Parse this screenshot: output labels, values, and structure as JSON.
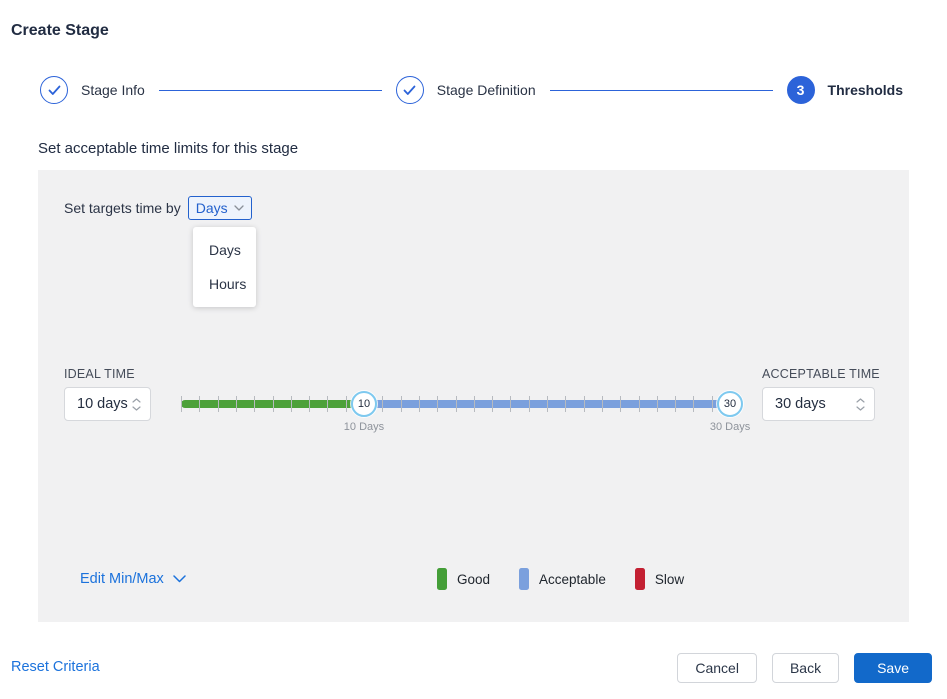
{
  "page": {
    "title": "Create Stage"
  },
  "stepper": {
    "steps": [
      {
        "label": "Stage Info",
        "state": "done"
      },
      {
        "label": "Stage Definition",
        "state": "done"
      },
      {
        "label": "Thresholds",
        "state": "active",
        "number": "3"
      }
    ]
  },
  "section": {
    "heading": "Set acceptable time limits for this stage"
  },
  "panel": {
    "target_label": "Set targets time by",
    "unit_dropdown": {
      "value": "Days",
      "options": [
        "Days",
        "Hours"
      ]
    },
    "ideal": {
      "label": "IDEAL TIME",
      "value": "10 days"
    },
    "acceptable": {
      "label": "ACCEPTABLE TIME",
      "value": "30 days"
    },
    "slider": {
      "min": 0,
      "max": 30,
      "tick_count": 31,
      "handles": [
        {
          "value": "10",
          "label": "10 Days",
          "percent": 32.33
        },
        {
          "value": "30",
          "label": "30 Days",
          "percent": 97
        }
      ],
      "colors": {
        "good": "#4da13a",
        "acceptable": "#7ba0dd",
        "handle_border": "#7ec9ef"
      }
    },
    "edit_minmax_label": "Edit Min/Max",
    "legend": [
      {
        "label": "Good",
        "color": "#449e38"
      },
      {
        "label": "Acceptable",
        "color": "#7ba0dd"
      },
      {
        "label": "Slow",
        "color": "#c32032"
      }
    ]
  },
  "footer": {
    "reset_label": "Reset Criteria",
    "cancel_label": "Cancel",
    "back_label": "Back",
    "save_label": "Save"
  }
}
